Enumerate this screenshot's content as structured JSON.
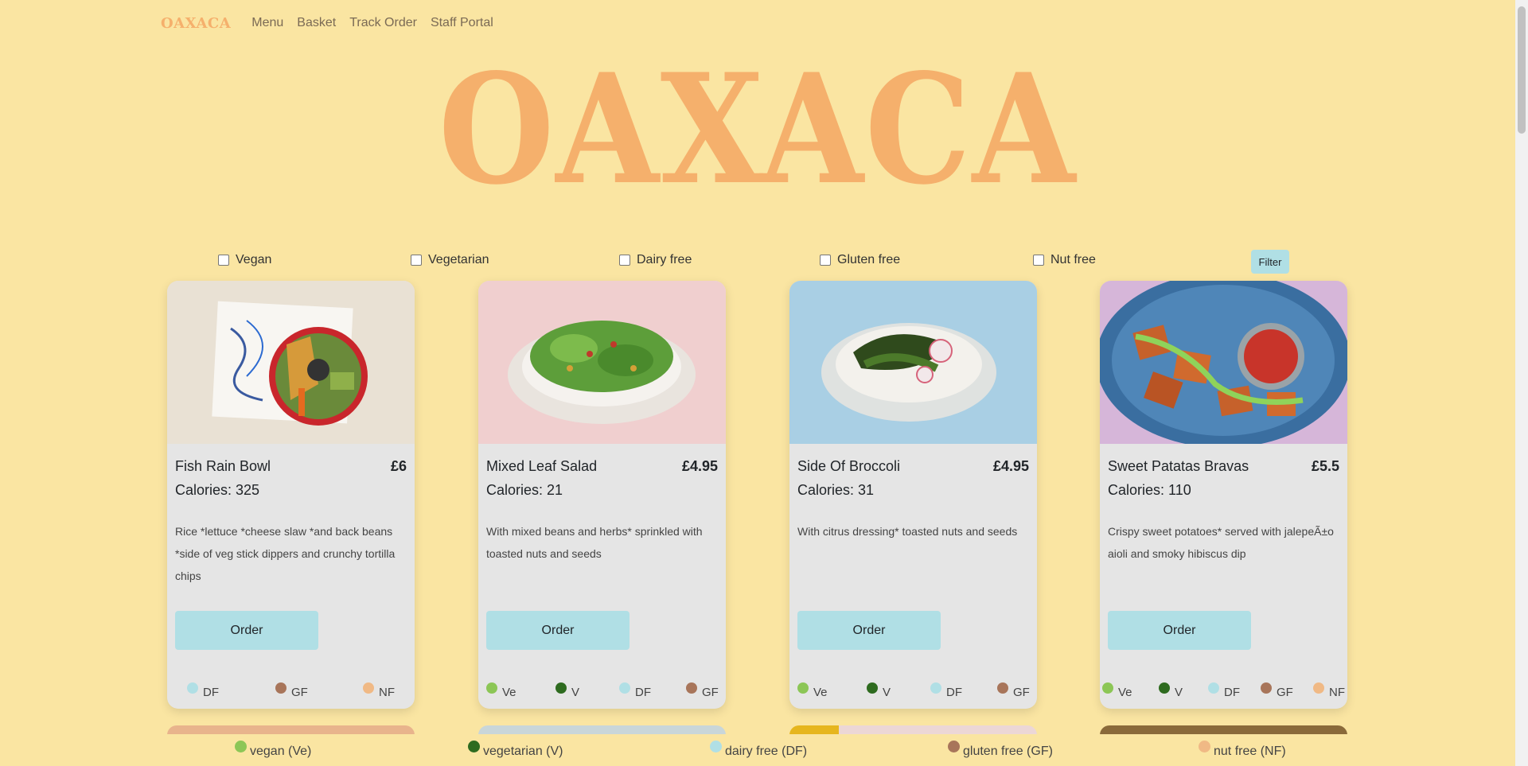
{
  "navbar": {
    "brand": "OAXACA",
    "links": [
      "Menu",
      "Basket",
      "Track Order",
      "Staff Portal"
    ]
  },
  "hero": {
    "title": "OAXACA"
  },
  "filters": {
    "options": [
      "Vegan",
      "Vegetarian",
      "Dairy free",
      "Gluten free",
      "Nut free"
    ],
    "button_label": "Filter"
  },
  "cards": [
    {
      "name": "Fish Rain Bowl",
      "price": "£6",
      "calories": "Calories: 325",
      "description": "Rice *lettuce *cheese slaw *and back beans *side of veg stick dippers and crunchy tortilla chips",
      "order_label": "Order",
      "tags": [
        "DF",
        "GF",
        "NF"
      ]
    },
    {
      "name": "Mixed Leaf Salad",
      "price": "£4.95",
      "calories": "Calories: 21",
      "description": "With mixed beans and herbs* sprinkled with toasted nuts and seeds",
      "order_label": "Order",
      "tags": [
        "Ve",
        "V",
        "DF",
        "GF"
      ]
    },
    {
      "name": "Side Of Broccoli",
      "price": "£4.95",
      "calories": "Calories: 31",
      "description": "With citrus dressing* toasted nuts and seeds",
      "order_label": "Order",
      "tags": [
        "Ve",
        "V",
        "DF",
        "GF"
      ]
    },
    {
      "name": "Sweet Patatas Bravas",
      "price": "£5.5",
      "calories": "Calories: 110",
      "description": "Crispy sweet potatoes* served with jalepeÃ±o aioli and smoky hibiscus dip",
      "order_label": "Order",
      "tags": [
        "Ve",
        "V",
        "DF",
        "GF",
        "NF"
      ]
    }
  ],
  "legend": [
    {
      "label": "vegan (Ve)",
      "color": "#8cc656"
    },
    {
      "label": "vegetarian (V)",
      "color": "#2e6b1f"
    },
    {
      "label": "dairy free (DF)",
      "color": "#b0dfe5"
    },
    {
      "label": "gluten free (GF)",
      "color": "#a8755a"
    },
    {
      "label": "nut free (NF)",
      "color": "#f0b985"
    }
  ],
  "colors": {
    "background": "#fae5a2",
    "brand": "#f5b06c",
    "button": "#b0dfe5",
    "card": "#e5e5e5"
  }
}
